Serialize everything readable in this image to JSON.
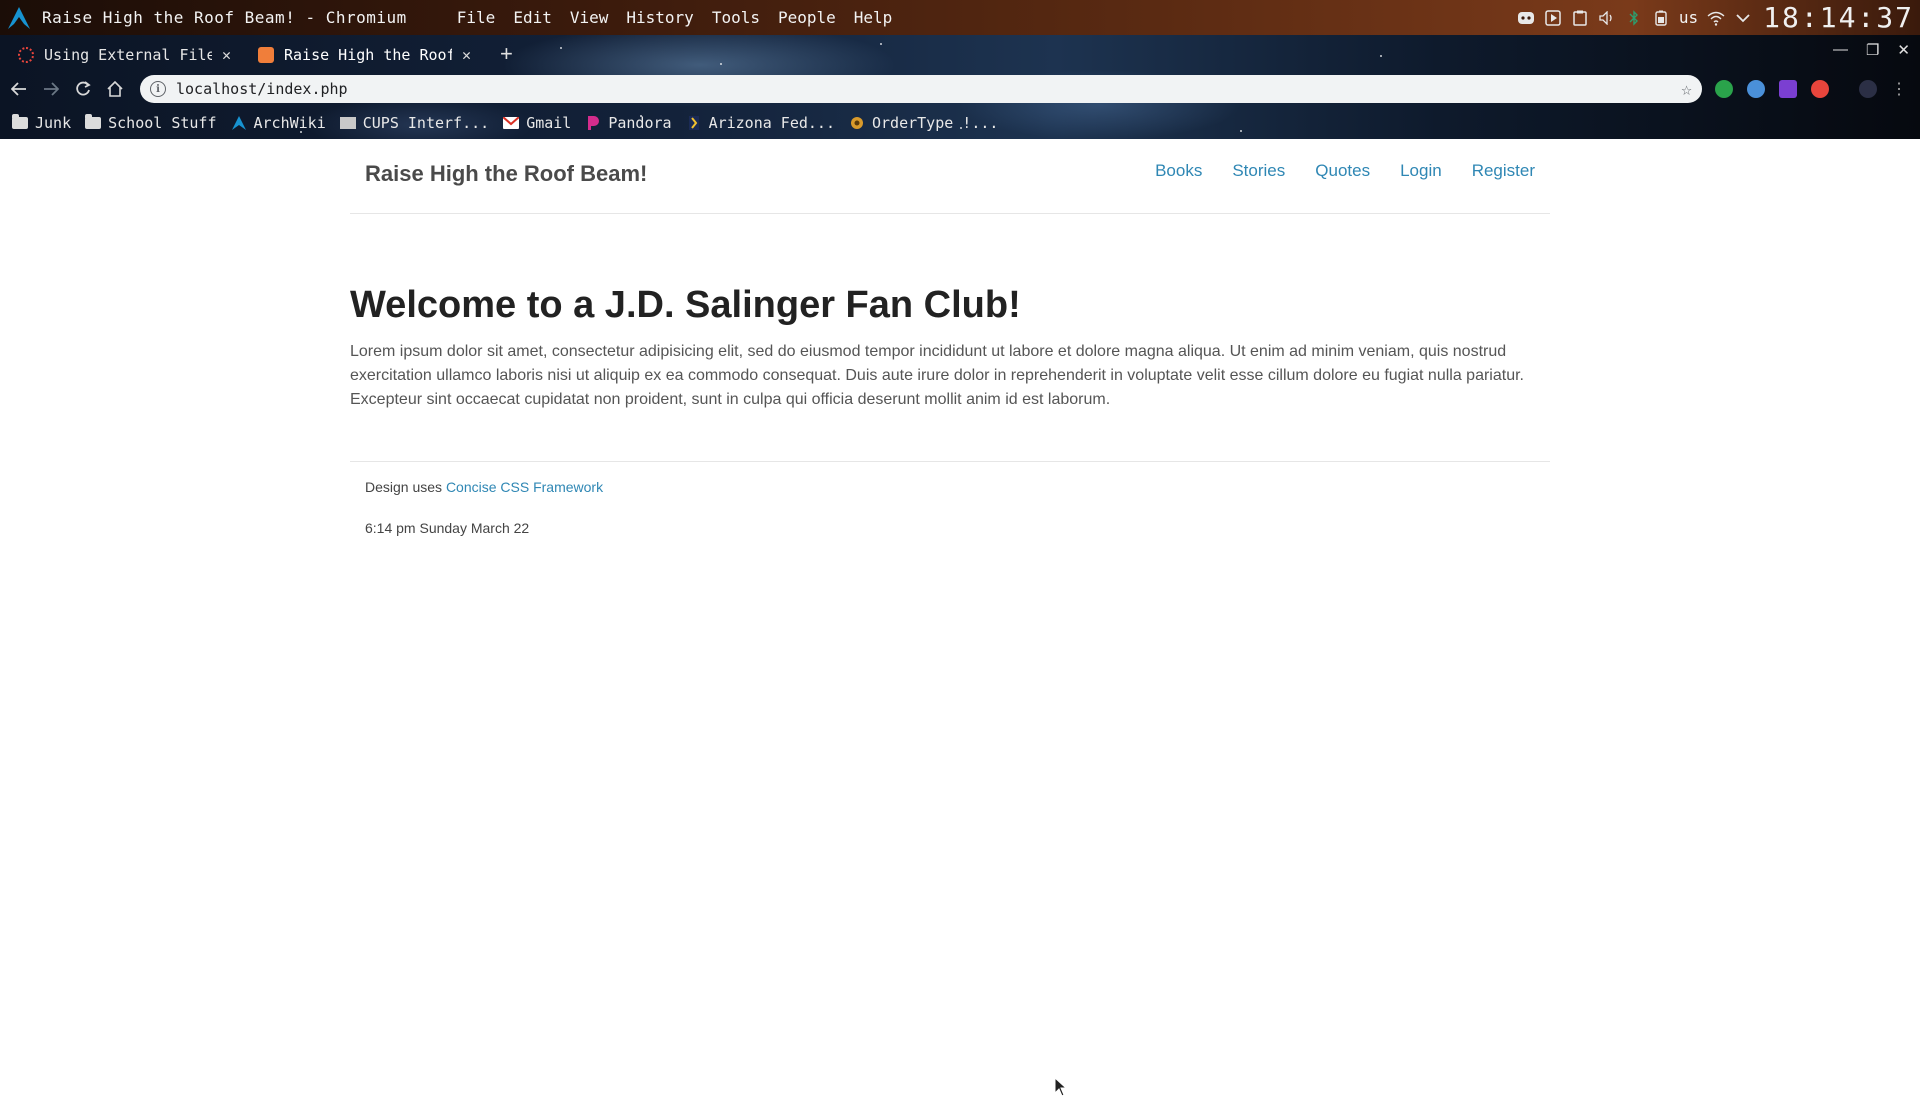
{
  "os_bar": {
    "window_title": "Raise High the Roof Beam! - Chromium",
    "menu": [
      "File",
      "Edit",
      "View",
      "History",
      "Tools",
      "People",
      "Help"
    ],
    "keyboard_layout": "us",
    "clock": "18:14:37",
    "tray_icons": [
      "discord-icon",
      "media-icon",
      "clipboard-icon",
      "volume-icon",
      "bluetooth-icon",
      "battery-icon",
      "wifi-icon",
      "chevron-down-icon"
    ]
  },
  "browser": {
    "tabs": [
      {
        "title": "Using External File",
        "active": false,
        "favicon_color": "#e8453c"
      },
      {
        "title": "Raise High the Roof",
        "active": true,
        "favicon_color": "#f07e3a"
      }
    ],
    "address": "localhost/index.php",
    "bookmarks": [
      {
        "label": "Junk",
        "icon": "folder-icon"
      },
      {
        "label": "School Stuff",
        "icon": "folder-icon"
      },
      {
        "label": "ArchWiki",
        "icon": "arch-icon"
      },
      {
        "label": "CUPS Interf...",
        "icon": "cups-icon"
      },
      {
        "label": "Gmail",
        "icon": "gmail-icon"
      },
      {
        "label": "Pandora",
        "icon": "pandora-icon"
      },
      {
        "label": "Arizona Fed...",
        "icon": "bank-icon"
      },
      {
        "label": "OrderType !...",
        "icon": "ordertype-icon"
      }
    ]
  },
  "site": {
    "title": "Raise High the Roof Beam!",
    "nav": [
      "Books",
      "Stories",
      "Quotes",
      "Login",
      "Register"
    ],
    "heading": "Welcome to a J.D. Salinger Fan Club!",
    "body_lines": [
      "Lorem ipsum dolor sit amet, consectetur adipisicing elit, sed do eiusmod tempor incididunt ut labore et dolore magna aliqua. Ut enim ad minim veniam, quis nostrud",
      "exercitation ullamco laboris nisi ut aliquip ex ea commodo consequat. Duis aute irure dolor in reprehenderit in voluptate velit esse cillum dolore eu fugiat nulla pariatur.",
      "Excepteur sint occaecat cupidatat non proident, sunt in culpa qui officia deserunt mollit anim id est laborum."
    ],
    "footer": {
      "design_prefix": "Design uses",
      "design_link": "Concise CSS Framework",
      "datetime": "6:14 pm Sunday March 22"
    }
  },
  "colors": {
    "link": "#2f87b4",
    "heading": "#222222",
    "body_text": "#555555"
  }
}
